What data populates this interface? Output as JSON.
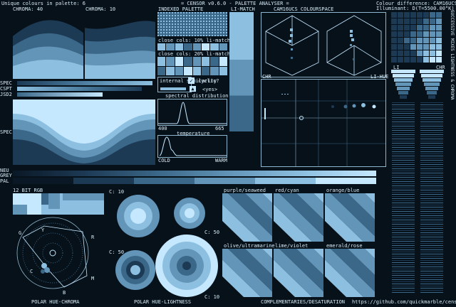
{
  "header": {
    "unique_colours": "Unique colours in palette: 6",
    "title": "= CENSOR v0.6.0 - PALETTE ANALYSER =",
    "colour_diff": "Colour difference: CAM16UCS",
    "illuminant": "Illuminant: D(T=5500.00°K)"
  },
  "labels": {
    "chroma40": "CHROMA: 40",
    "chroma10": "CHROMA: 10",
    "indexed_palette": "INDEXED PALETTE",
    "li_match": "LI-MATCH",
    "cam16_space": "CAM16UCS COLOURSPACE",
    "close_cols_10": "close cols: 10% li-match",
    "close_cols_20": "close cols: 20% li-match",
    "internal_similarity": "internal similarity",
    "cyclic": "cyclic?",
    "yes": "<yes>",
    "spectral_distribution": "spectral distribution",
    "wl_min": "400",
    "wl_max": "665",
    "temperature": "temperature",
    "cold": "COLD",
    "warm": "WARM",
    "spec": "SPEC",
    "cspt": "CSPT",
    "jsd2": "JSD2",
    "spec_bbd": "SPEC BBD",
    "neu": "NEU",
    "grey": "GREY",
    "pal": "PAL",
    "chr": "CHR",
    "li_hue": "LI-HUE",
    "li": "LI",
    "chr2": "CHR",
    "side_text": "SUCCESSIVE MIXES   LIGHTNESS & CHROMA",
    "rgb12": "12 BIT RGB",
    "c10a": "C: 10",
    "c50a": "C: 50",
    "c50b": "C: 50",
    "c10b": "C: 10",
    "purple_seaweed": "purple/seaweed",
    "red_cyan": "red/cyan",
    "orange_blue": "orange/blue",
    "olive_ultramarine": "olive/ultramarine",
    "lime_violet": "lime/violet",
    "emerald_rose": "emerald/rose",
    "polar_hc": "POLAR HUE-CHROMA",
    "polar_hl": "POLAR HUE-LIGHTNESS",
    "complementaries": "COMPLEMENTARIES/DESATURATION",
    "url": "https://github.com/quickmarble/censor",
    "hue_g": "G",
    "hue_y": "Y",
    "hue_r": "R",
    "hue_c": "C",
    "hue_m": "M",
    "hue_b": "B"
  },
  "palette": [
    "#0a1826",
    "#1d3a55",
    "#3b6788",
    "#6295b8",
    "#8dc0e0",
    "#c5e8ff"
  ],
  "accent": "#8fb6cc"
}
